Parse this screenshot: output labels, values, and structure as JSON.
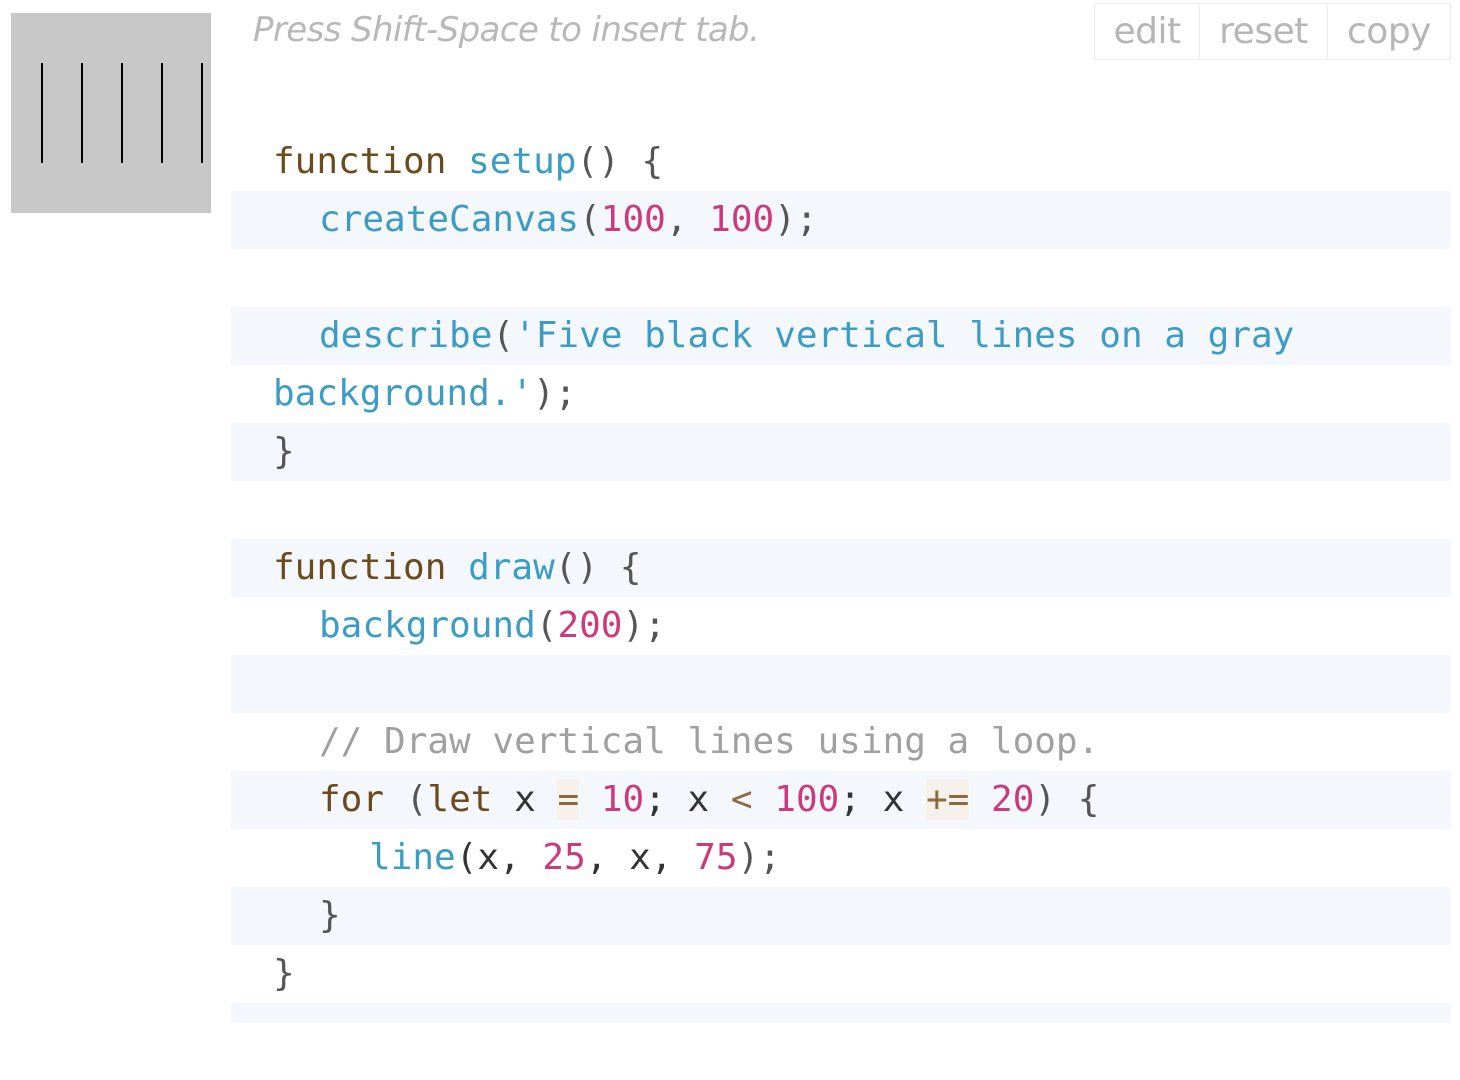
{
  "hint": "Press Shift-Space to insert tab.",
  "buttons": {
    "edit": "edit",
    "reset": "reset",
    "copy": "copy"
  },
  "sketch": {
    "background": "#c8c8c8",
    "line_color": "#000000",
    "line_count": 5
  },
  "colors": {
    "keyword": "#6b4a1e",
    "function": "#3d9cc4",
    "number": "#cb3a7d",
    "comment": "#a0a0a0",
    "line_highlight": "#f4f7fc"
  },
  "code": {
    "l1": {
      "kw": "function",
      "fn": "setup",
      "rest": "() {"
    },
    "l2": {
      "fn": "createCanvas",
      "open": "(",
      "n1": "100",
      "sep": ", ",
      "n2": "100",
      "close": ");"
    },
    "l3": {},
    "l4": {
      "fn": "describe",
      "open": "(",
      "str": "'Five black vertical lines on a gray"
    },
    "l5": {
      "str": "background.'",
      "close": ");"
    },
    "l6": {
      "text": "}"
    },
    "l7": {},
    "l8": {
      "kw": "function",
      "fn": "draw",
      "rest": "() {"
    },
    "l9": {
      "fn": "background",
      "open": "(",
      "n1": "200",
      "close": ");"
    },
    "l10": {},
    "l11": {
      "comment": "// Draw vertical lines using a loop."
    },
    "l12": {
      "kw_for": "for",
      "p1": " (",
      "kw_let": "let",
      "v1": " x ",
      "op1": "=",
      "n1": "10",
      "s1": "; x ",
      "op2": "<",
      "n2": "100",
      "s2": "; x ",
      "op3": "+=",
      "n3": "20",
      "tail": ") {"
    },
    "l13": {
      "fn": "line",
      "a1": "(x, ",
      "n1": "25",
      "a2": ", x, ",
      "n2": "75",
      "close": ");"
    },
    "l14": {
      "text": "}"
    },
    "l15": {
      "text": "}"
    }
  }
}
